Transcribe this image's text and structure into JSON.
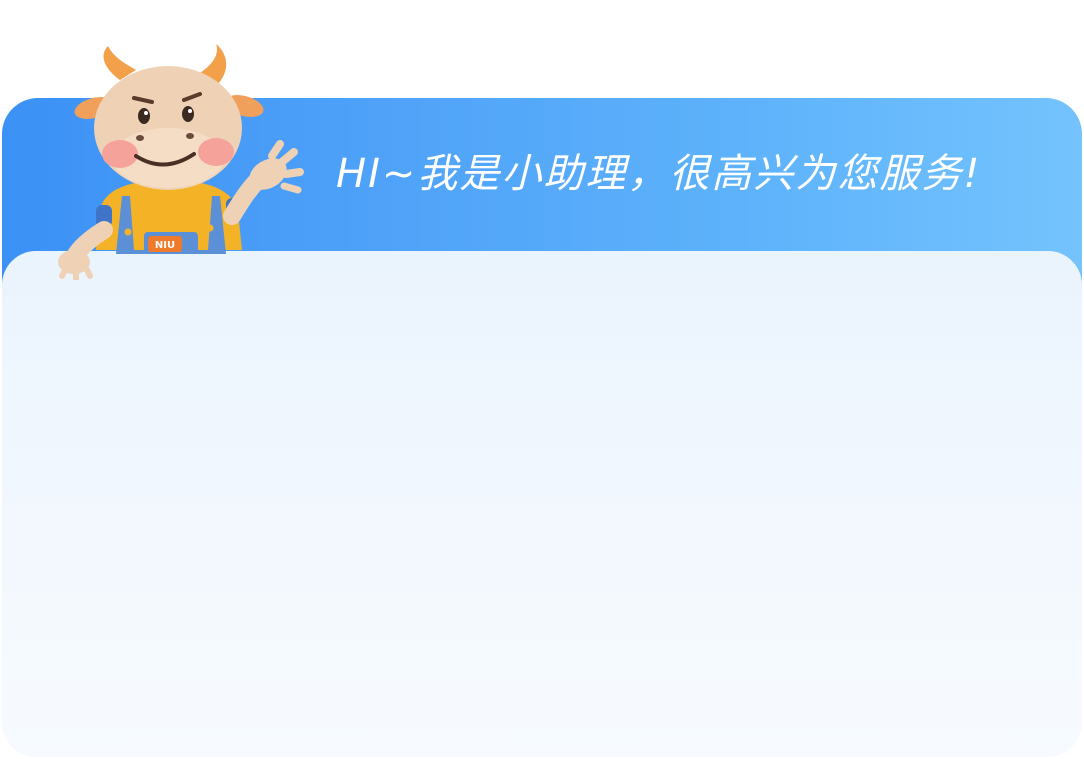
{
  "header": {
    "greeting": "HI~我是小助理，很高兴为您服务!"
  },
  "mascot": {
    "icon": "cow-mascot-icon",
    "badge_text": "NIU"
  },
  "colors": {
    "banner_start": "#3b91f5",
    "banner_end": "#74c3fd",
    "card_top": "#eaf4fd",
    "card_bottom": "#f7fbff"
  }
}
